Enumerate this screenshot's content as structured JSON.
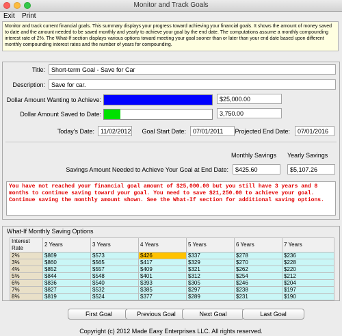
{
  "window": {
    "title": "Monitor and Track Goals"
  },
  "menu": {
    "exit": "Exit",
    "print": "Print"
  },
  "info_text": "Monitor and track current financial goals. This summary displays your progress toward achieving your financial goals. It shows the amount of money saved to date and the amount needed to be saved monthly and yearly to achieve your goal by the end date. The computations assume a monthly compounding interest rate of 2%. The What-If section displays various options toward meeting your goal sooner than or later than your end date based upon different monthly compounding interest rates and the number of years for compounding.",
  "form": {
    "title_label": "Title:",
    "title_value": "Short-term Goal - Save for Car",
    "description_label": "Description:",
    "description_value": "Save for car.",
    "want_label": "Dollar Amount Wanting to Achieve:",
    "want_value": "$25,000.00",
    "want_fill_fraction": 1.0,
    "want_bar_color": "#0000ff",
    "saved_label": "Dollar Amount Saved to Date:",
    "saved_value": "3,750.00",
    "saved_fill_fraction": 0.15,
    "saved_bar_color": "#00e000",
    "today_label": "Today's Date:",
    "today_value": "11/02/2012",
    "start_label": "Goal Start Date:",
    "start_value": "07/01/2011",
    "end_label": "Projected End Date:",
    "end_value": "07/01/2016",
    "monthly_header": "Monthly Savings",
    "yearly_header": "Yearly Savings",
    "needed_label": "Savings Amount Needed to Achieve Your Goal at End Date:",
    "monthly_value": "$425.60",
    "yearly_value": "$5,107.26"
  },
  "message": "You have not reached your financial goal amount of $25,000.00 but you still have 3 years and 8 months to continue saving toward your goal. You need to save $21,250.00 to achieve your goal. Continue saving the monthly amount shown. See the What-If section for additional saving options.",
  "whatif": {
    "title": "What-If Monthly Saving Options",
    "headers": [
      "Interest Rate",
      "2 Years",
      "3 Years",
      "4 Years",
      "5 Years",
      "6 Years",
      "7 Years"
    ],
    "rows": [
      [
        "2%",
        "$869",
        "$573",
        "$426",
        "$337",
        "$278",
        "$236"
      ],
      [
        "3%",
        "$860",
        "$565",
        "$417",
        "$329",
        "$270",
        "$228"
      ],
      [
        "4%",
        "$852",
        "$557",
        "$409",
        "$321",
        "$262",
        "$220"
      ],
      [
        "5%",
        "$844",
        "$548",
        "$401",
        "$312",
        "$254",
        "$212"
      ],
      [
        "6%",
        "$836",
        "$540",
        "$393",
        "$305",
        "$246",
        "$204"
      ],
      [
        "7%",
        "$827",
        "$532",
        "$385",
        "$297",
        "$238",
        "$197"
      ],
      [
        "8%",
        "$819",
        "$524",
        "$377",
        "$289",
        "$231",
        "$190"
      ]
    ],
    "highlight_color": "#ffc200",
    "cell_color": "#c9f6f6"
  },
  "buttons": {
    "first": "First Goal",
    "previous": "Previous Goal",
    "next": "Next Goal",
    "last": "Last Goal"
  },
  "copyright": "Copyright (c) 2012 Made Easy Enterprises LLC. All rights reserved."
}
